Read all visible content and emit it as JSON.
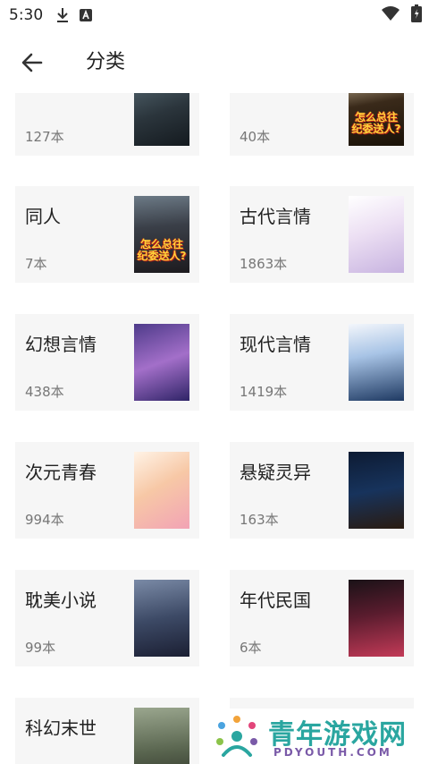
{
  "status_bar": {
    "time": "5:30",
    "icons_left": [
      "download-icon",
      "a-app-icon"
    ],
    "icons_right": [
      "wifi-icon",
      "battery-icon"
    ]
  },
  "app_bar": {
    "back_icon": "arrow-left-icon",
    "title": "分类"
  },
  "categories": [
    {
      "name": "",
      "count": "127本"
    },
    {
      "name": "",
      "count": "40本"
    },
    {
      "name": "同人",
      "count": "7本"
    },
    {
      "name": "古代言情",
      "count": "1863本"
    },
    {
      "name": "幻想言情",
      "count": "438本"
    },
    {
      "name": "现代言情",
      "count": "1419本"
    },
    {
      "name": "次元青春",
      "count": "994本"
    },
    {
      "name": "悬疑灵异",
      "count": "163本"
    },
    {
      "name": "耽美小说",
      "count": "99本"
    },
    {
      "name": "年代民国",
      "count": "6本"
    },
    {
      "name": "科幻末世",
      "count": ""
    },
    {
      "name": "",
      "count": ""
    }
  ],
  "covers": {
    "c1_text": "怎么总往\n纪委送人?",
    "c2_text": "怎么总往\n纪委送人?"
  },
  "watermark": {
    "cn": "青年游戏网",
    "en": "PDYOUTH.COM"
  },
  "colors": {
    "card_bg": "#f6f6f6",
    "text_primary": "#222222",
    "text_secondary": "#777777",
    "watermark_teal": "#2aa6a0",
    "watermark_purple": "#7a5aa8"
  }
}
